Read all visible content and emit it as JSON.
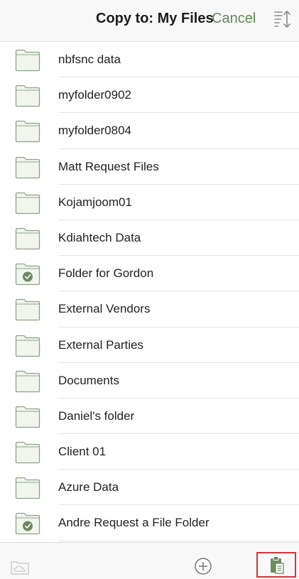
{
  "header": {
    "title": "Copy to: My Files",
    "cancel_label": "Cancel",
    "sort_icon": "sort-icon"
  },
  "colors": {
    "accent": "#5f8a55",
    "folder_fill": "#f1f5ee",
    "folder_stroke": "#8fa28a",
    "highlight": "#d9343a"
  },
  "folders": [
    {
      "name": "nbfsnc data",
      "icon": "folder-icon",
      "shared": false
    },
    {
      "name": "myfolder0902",
      "icon": "folder-icon",
      "shared": false
    },
    {
      "name": "myfolder0804",
      "icon": "folder-icon",
      "shared": false
    },
    {
      "name": "Matt Request Files",
      "icon": "folder-icon",
      "shared": false
    },
    {
      "name": "Kojamjoom01",
      "icon": "folder-icon",
      "shared": false
    },
    {
      "name": "Kdiahtech Data",
      "icon": "folder-icon",
      "shared": false
    },
    {
      "name": "Folder for Gordon",
      "icon": "request-folder-icon",
      "shared": true
    },
    {
      "name": "External Vendors",
      "icon": "folder-icon",
      "shared": false
    },
    {
      "name": "External Parties",
      "icon": "folder-icon",
      "shared": false
    },
    {
      "name": "Documents",
      "icon": "folder-icon",
      "shared": false
    },
    {
      "name": "Daniel's folder",
      "icon": "folder-icon",
      "shared": false
    },
    {
      "name": "Client 01",
      "icon": "folder-icon",
      "shared": false
    },
    {
      "name": "Azure Data",
      "icon": "folder-icon",
      "shared": false
    },
    {
      "name": "Andre Request a File Folder",
      "icon": "request-folder-icon",
      "shared": true
    }
  ],
  "toolbar": {
    "left_icon": "cloud-folder-icon",
    "center_icon": "add-circle-icon",
    "right_icon": "paste-icon"
  }
}
